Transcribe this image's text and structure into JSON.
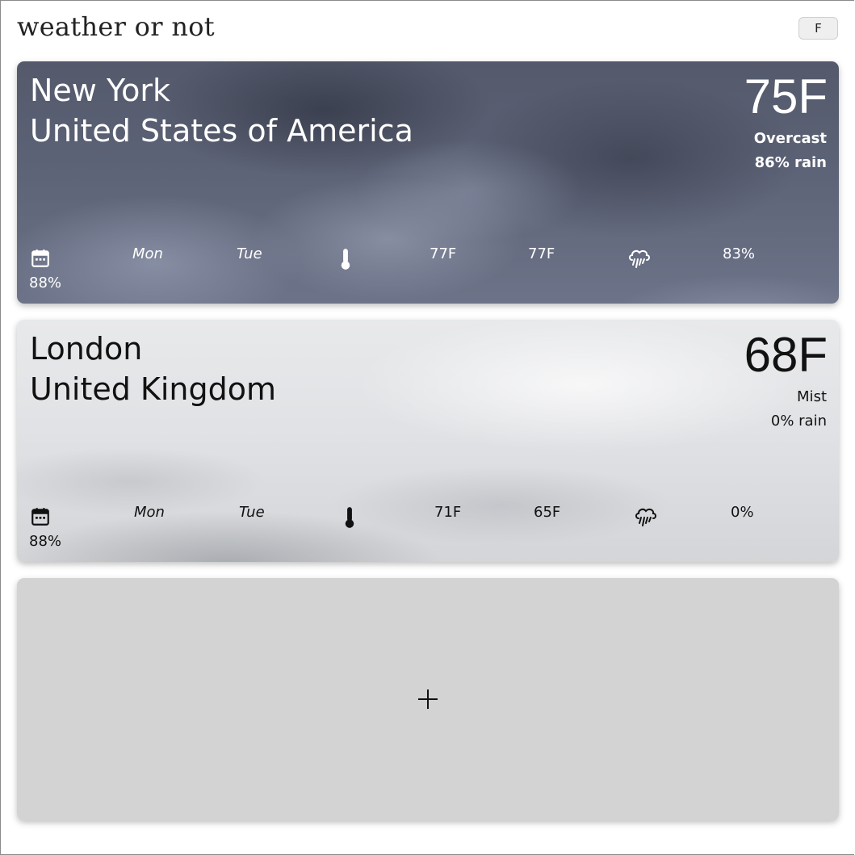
{
  "app": {
    "title": "weather or not",
    "unit_toggle_label": "F"
  },
  "cards": [
    {
      "city": "New York",
      "country": "United States of America",
      "temperature": "75F",
      "condition": "Overcast",
      "rain_chance": "86% rain",
      "forecast": {
        "days": [
          "Mon",
          "Tue"
        ],
        "temps": [
          "77F",
          "77F"
        ],
        "precip": "83%",
        "extra_pct": "88%"
      },
      "icons": [
        "calendar-icon",
        "thermometer-icon",
        "rain-cloud-icon"
      ]
    },
    {
      "city": "London",
      "country": "United Kingdom",
      "temperature": "68F",
      "condition": "Mist",
      "rain_chance": "0% rain",
      "forecast": {
        "days": [
          "Mon",
          "Tue"
        ],
        "temps": [
          "71F",
          "65F"
        ],
        "precip": "0%",
        "extra_pct": "88%"
      },
      "icons": [
        "calendar-icon",
        "thermometer-icon",
        "rain-cloud-icon"
      ]
    }
  ],
  "add_card": {
    "icon": "plus-icon"
  },
  "colors": {
    "ny_text": "#ffffff",
    "london_text": "#111111",
    "add_card_bg": "#d3d3d3",
    "toggle_bg": "#efefef"
  }
}
